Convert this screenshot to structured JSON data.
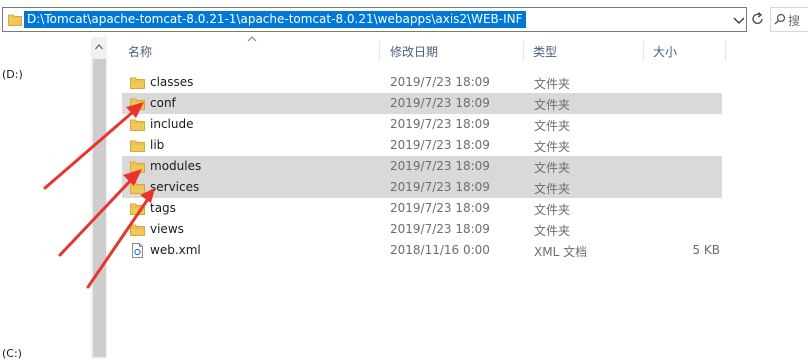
{
  "address_bar": {
    "path": "D:\\Tomcat\\apache-tomcat-8.0.21-1\\apache-tomcat-8.0.21\\webapps\\axis2\\WEB-INF",
    "search_placeholder": "搜"
  },
  "nav": {
    "items": [
      {
        "label": "(D:)"
      },
      {
        "label": "(C:)"
      }
    ]
  },
  "columns": {
    "name": "名称",
    "modified": "修改日期",
    "type": "类型",
    "size": "大小"
  },
  "files": [
    {
      "name": "classes",
      "modified": "2019/7/23 18:09",
      "type": "文件夹",
      "size": "",
      "icon": "folder-icon",
      "selected": false
    },
    {
      "name": "conf",
      "modified": "2019/7/23 18:09",
      "type": "文件夹",
      "size": "",
      "icon": "folder-icon",
      "selected": true
    },
    {
      "name": "include",
      "modified": "2019/7/23 18:09",
      "type": "文件夹",
      "size": "",
      "icon": "folder-icon",
      "selected": false
    },
    {
      "name": "lib",
      "modified": "2019/7/23 18:09",
      "type": "文件夹",
      "size": "",
      "icon": "folder-icon",
      "selected": false
    },
    {
      "name": "modules",
      "modified": "2019/7/23 18:09",
      "type": "文件夹",
      "size": "",
      "icon": "folder-icon",
      "selected": true
    },
    {
      "name": "services",
      "modified": "2019/7/23 18:09",
      "type": "文件夹",
      "size": "",
      "icon": "folder-icon",
      "selected": true
    },
    {
      "name": "tags",
      "modified": "2019/7/23 18:09",
      "type": "文件夹",
      "size": "",
      "icon": "folder-icon",
      "selected": false
    },
    {
      "name": "views",
      "modified": "2019/7/23 18:09",
      "type": "文件夹",
      "size": "",
      "icon": "folder-icon",
      "selected": false
    },
    {
      "name": "web.xml",
      "modified": "2018/11/16 0:00",
      "type": "XML 文档",
      "size": "5 KB",
      "icon": "xml-file-icon",
      "selected": false
    }
  ],
  "colors": {
    "selection_highlight": "#0078d7",
    "selected_row": "#d9d9d9",
    "folder": "#f0c85a",
    "annotation_arrow": "#e8352b"
  }
}
